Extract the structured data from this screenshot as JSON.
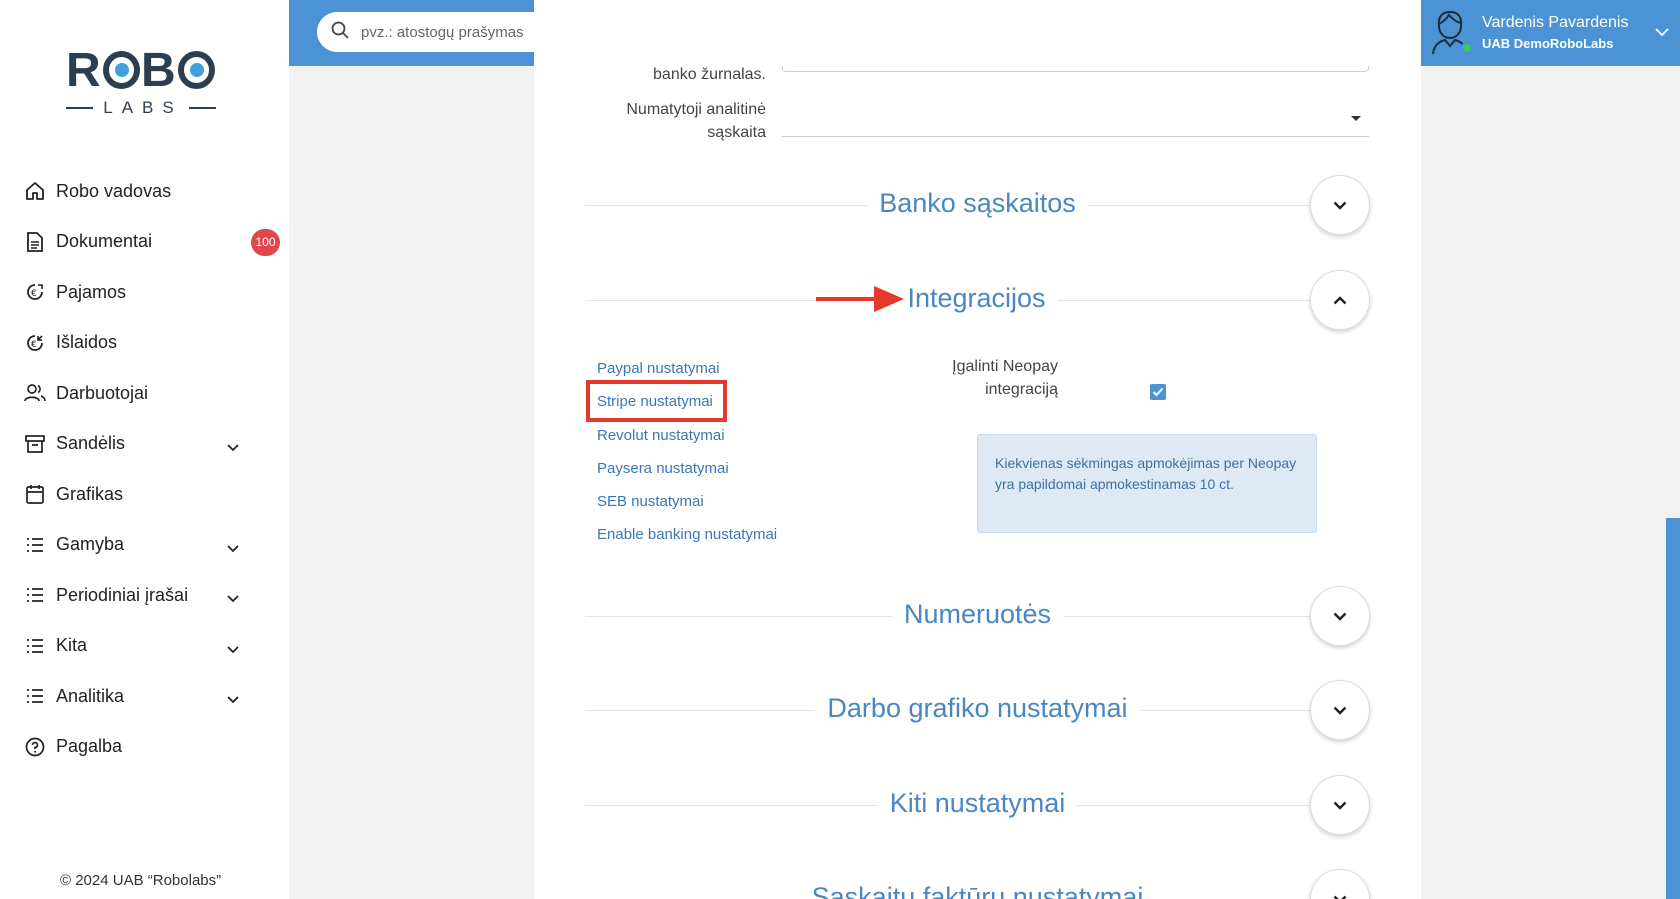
{
  "sidebar": {
    "logo_top": "ROBO",
    "logo_bottom": "LABS",
    "items": [
      {
        "label": "Robo vadovas",
        "icon": "home-icon"
      },
      {
        "label": "Dokumentai",
        "icon": "document-icon",
        "badge": "100"
      },
      {
        "label": "Pajamos",
        "icon": "income-icon"
      },
      {
        "label": "Išlaidos",
        "icon": "expenses-icon"
      },
      {
        "label": "Darbuotojai",
        "icon": "users-icon"
      },
      {
        "label": "Sandėlis",
        "icon": "archive-icon",
        "expandable": true
      },
      {
        "label": "Grafikas",
        "icon": "calendar-icon"
      },
      {
        "label": "Gamyba",
        "icon": "list-icon",
        "expandable": true
      },
      {
        "label": "Periodiniai įrašai",
        "icon": "list-icon",
        "expandable": true
      },
      {
        "label": "Kita",
        "icon": "list-icon",
        "expandable": true
      },
      {
        "label": "Analitika",
        "icon": "list-icon",
        "expandable": true
      },
      {
        "label": "Pagalba",
        "icon": "help-icon"
      }
    ],
    "copyright": "© 2024 UAB “Robolabs”"
  },
  "header": {
    "search_placeholder": "pvz.: atostogų prašymas",
    "user_name": "Vardenis Pavardenis",
    "company": "UAB DemoRoboLabs"
  },
  "form": {
    "bank_journal_label": "banko žurnalas.",
    "analytic_account_label": "Numatytoji analitinė sąskaita"
  },
  "sections": {
    "bank_accounts": "Banko sąskaitos",
    "integrations": "Integracijos",
    "numbering": "Numeruotės",
    "work_schedule": "Darbo grafiko nustatymai",
    "other_settings": "Kiti nustatymai",
    "invoice_settings": "Sąskaitų faktūrų nustatymai"
  },
  "integrations": {
    "links": [
      "Paypal nustatymai",
      "Stripe nustatymai",
      "Revolut nustatymai",
      "Paysera nustatymai",
      "SEB nustatymai",
      "Enable banking nustatymai"
    ],
    "neopay_label": "Įgalinti Neopay integraciją",
    "neopay_enabled": true,
    "info_text": "Kiekvienas sėkmingas apmokėjimas per Neopay yra papildomai apmokestinamas 10 ct."
  },
  "colors": {
    "topbar": "#4b93d5",
    "accent_link": "#3a78b5",
    "highlight": "#e53a2b",
    "badge": "#e0474c"
  }
}
